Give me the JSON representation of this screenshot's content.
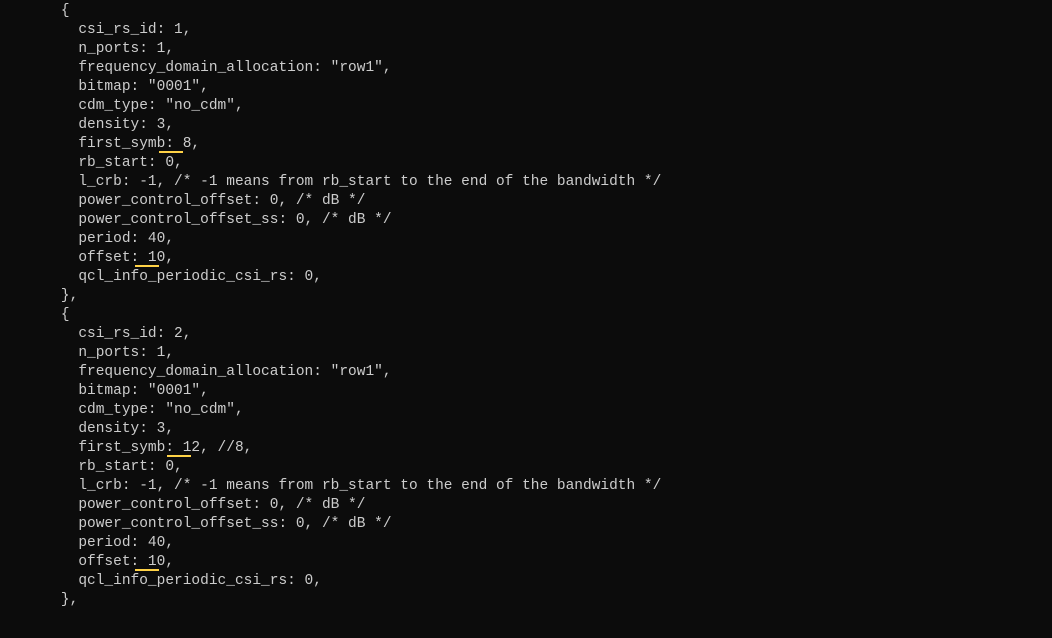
{
  "code": {
    "lines": [
      {
        "indent": 7,
        "text": "{"
      },
      {
        "indent": 9,
        "text": "csi_rs_id: 1,"
      },
      {
        "indent": 9,
        "text": "n_ports: 1,"
      },
      {
        "indent": 9,
        "text": "frequency_domain_allocation: \"row1\","
      },
      {
        "indent": 9,
        "text": "bitmap: \"0001\","
      },
      {
        "indent": 9,
        "text": "cdm_type: \"no_cdm\","
      },
      {
        "indent": 9,
        "text": "density: 3,"
      },
      {
        "indent": 9,
        "text": "first_symb: 8,",
        "underline": {
          "start": 11,
          "len": 3
        }
      },
      {
        "indent": 9,
        "text": "rb_start: 0,"
      },
      {
        "indent": 9,
        "text": "l_crb: -1, /* -1 means from rb_start to the end of the bandwidth */"
      },
      {
        "indent": 9,
        "text": "power_control_offset: 0, /* dB */"
      },
      {
        "indent": 9,
        "text": "power_control_offset_ss: 0, /* dB */"
      },
      {
        "indent": 9,
        "text": "period: 40,"
      },
      {
        "indent": 9,
        "text": "offset: 10,",
        "underline": {
          "start": 8,
          "len": 3
        }
      },
      {
        "indent": 9,
        "text": "qcl_info_periodic_csi_rs: 0,"
      },
      {
        "indent": 7,
        "text": "},"
      },
      {
        "indent": 7,
        "text": "{"
      },
      {
        "indent": 9,
        "text": "csi_rs_id: 2,"
      },
      {
        "indent": 9,
        "text": "n_ports: 1,"
      },
      {
        "indent": 9,
        "text": "frequency_domain_allocation: \"row1\","
      },
      {
        "indent": 9,
        "text": "bitmap: \"0001\","
      },
      {
        "indent": 9,
        "text": "cdm_type: \"no_cdm\","
      },
      {
        "indent": 9,
        "text": "density: 3,"
      },
      {
        "indent": 9,
        "text": "first_symb: 12, //8,",
        "underline": {
          "start": 12,
          "len": 3
        }
      },
      {
        "indent": 9,
        "text": "rb_start: 0,"
      },
      {
        "indent": 9,
        "text": "l_crb: -1, /* -1 means from rb_start to the end of the bandwidth */"
      },
      {
        "indent": 9,
        "text": "power_control_offset: 0, /* dB */"
      },
      {
        "indent": 9,
        "text": "power_control_offset_ss: 0, /* dB */"
      },
      {
        "indent": 9,
        "text": "period: 40,"
      },
      {
        "indent": 9,
        "text": "offset: 10,",
        "underline": {
          "start": 8,
          "len": 3
        }
      },
      {
        "indent": 9,
        "text": "qcl_info_periodic_csi_rs: 0,"
      },
      {
        "indent": 7,
        "text": "},"
      }
    ]
  },
  "style": {
    "charWidthPx": 7.97,
    "underlineColor": "#ffd246"
  }
}
